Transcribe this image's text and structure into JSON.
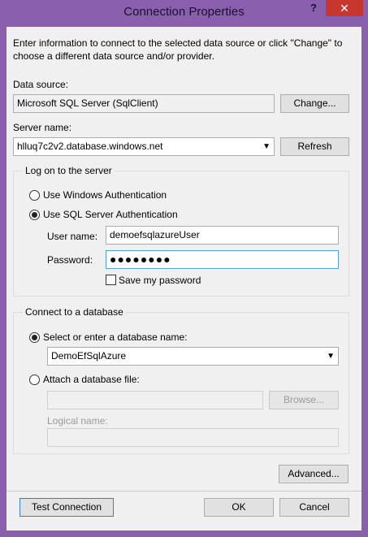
{
  "window": {
    "title": "Connection Properties",
    "help_symbol": "?",
    "close_symbol": "✕"
  },
  "intro_text_line1": "Enter information to connect to the selected data source or click \"Change\" to",
  "intro_text_line2": "choose a different data source and/or provider.",
  "data_source": {
    "label": "Data source:",
    "value": "Microsoft SQL Server (SqlClient)",
    "change_label": "Change..."
  },
  "server": {
    "label": "Server name:",
    "value": "hlluq7c2v2.database.windows.net",
    "refresh_label": "Refresh"
  },
  "logon": {
    "group_title": "Log on to the server",
    "windows_auth_label": "Use Windows Authentication",
    "sql_auth_label": "Use SQL Server Authentication",
    "selected": "sql",
    "username_label": "User name:",
    "username_value": "demoefsqlazureUser",
    "password_label": "Password:",
    "password_value": "●●●●●●●●",
    "save_password_label": "Save my password",
    "save_password_checked": false
  },
  "database": {
    "group_title": "Connect to a database",
    "select_label": "Select or enter a database name:",
    "select_value": "DemoEfSqlAzure",
    "attach_label": "Attach a database file:",
    "attach_value": "",
    "browse_label": "Browse...",
    "logical_name_label": "Logical name:",
    "logical_name_value": ""
  },
  "footer": {
    "advanced_label": "Advanced...",
    "test_connection_label": "Test Connection",
    "ok_label": "OK",
    "cancel_label": "Cancel"
  }
}
